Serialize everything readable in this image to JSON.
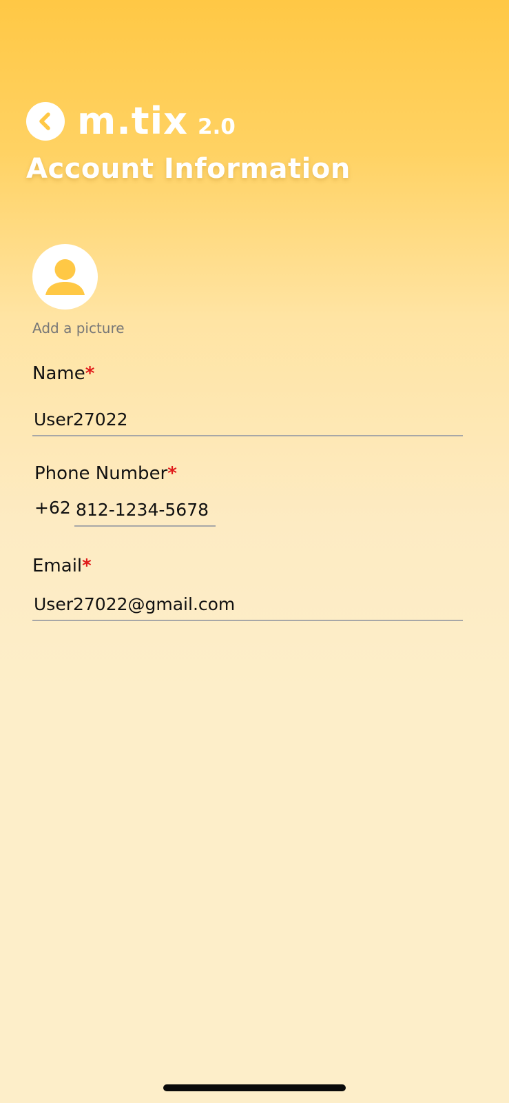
{
  "header": {
    "logo_main": "m.tix",
    "logo_version": "2.0",
    "title": "Account Information"
  },
  "avatar": {
    "add_picture_label": "Add a picture"
  },
  "form": {
    "required_mark": "*",
    "name": {
      "label": "Name",
      "value": "User27022"
    },
    "phone": {
      "label": "Phone Number",
      "country_code": "+62",
      "value": "812-1234-5678"
    },
    "email": {
      "label": "Email",
      "value": "User27022@gmail.com"
    }
  },
  "icons": {
    "back": "chevron-left-icon",
    "avatar": "person-icon"
  },
  "colors": {
    "gradient_top": "#ffc845",
    "gradient_bottom": "#fdeec9",
    "required": "#e01a1a",
    "underline": "#a7a7a7",
    "hint_text": "#777777"
  }
}
